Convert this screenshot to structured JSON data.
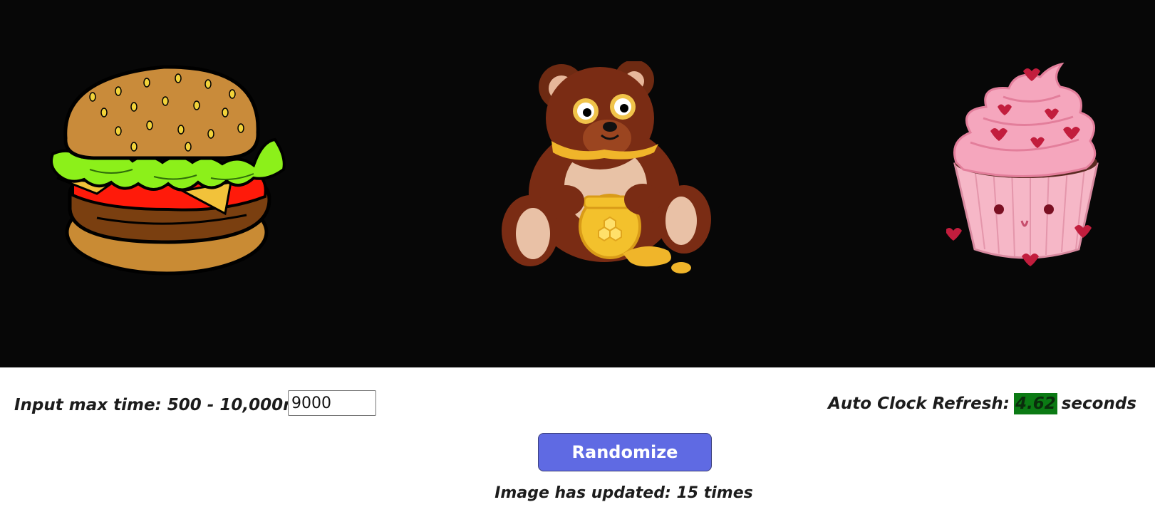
{
  "images": {
    "left": "burger-image",
    "center": "bear-honey-image",
    "right": "cupcake-image"
  },
  "controls": {
    "max_time_label": "Input max time: 500 - 10,000ms",
    "max_time_value": "9000",
    "clock_label": "Auto Clock Refresh:",
    "clock_value": "4.62",
    "clock_unit": "seconds",
    "randomize_label": "Randomize",
    "update_prefix": "Image has updated:",
    "update_count": "15",
    "update_suffix": "times"
  },
  "colors": {
    "stage_bg": "#070707",
    "button_bg": "#5f6ae3",
    "clock_highlight": "#0b7a14"
  }
}
